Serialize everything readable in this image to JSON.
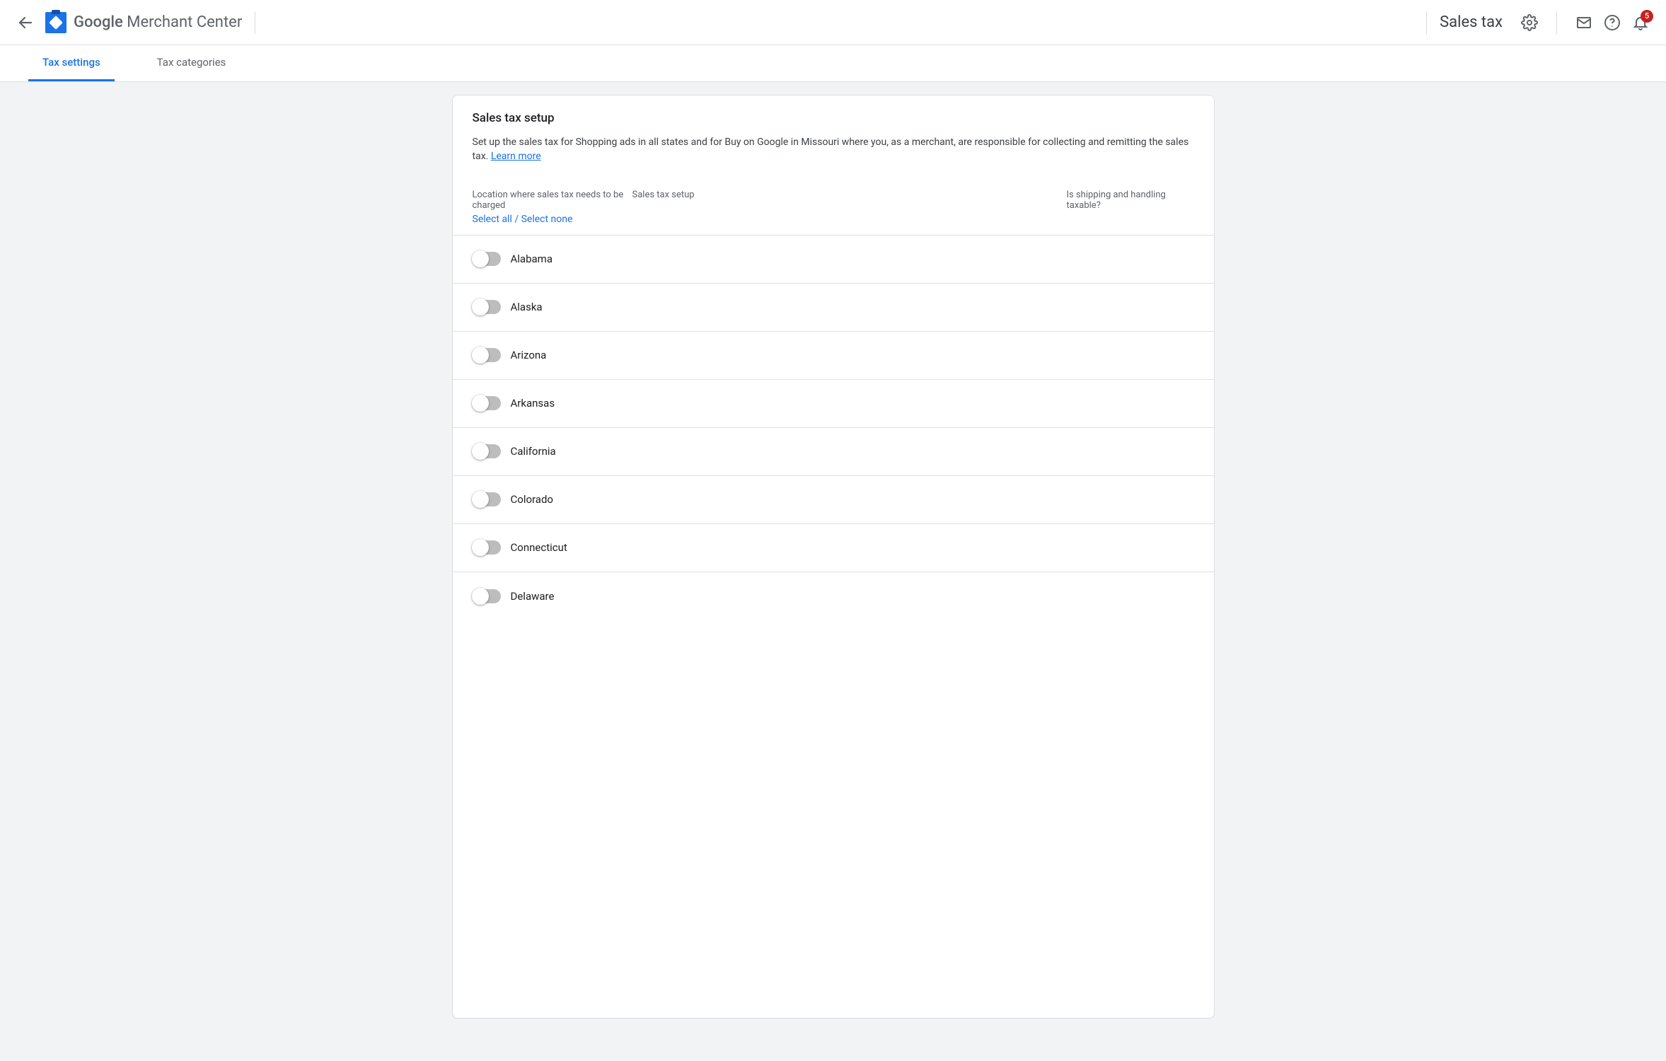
{
  "header": {
    "brand_google": "Google",
    "brand_product": "Merchant Center",
    "page_title": "Sales tax",
    "notification_count": "5"
  },
  "tabs": [
    {
      "label": "Tax settings",
      "active": true
    },
    {
      "label": "Tax categories",
      "active": false
    }
  ],
  "card": {
    "title": "Sales tax setup",
    "description": "Set up the sales tax for Shopping ads in all states and for Buy on Google in Missouri where you, as a merchant, are responsible for collecting and remitting the sales tax. ",
    "learn_more": "Learn more",
    "columns": {
      "location": "Location where sales tax needs to be charged",
      "setup": "Sales tax setup",
      "shipping": "Is shipping and handling taxable?"
    },
    "select_all": "Select all",
    "select_none": "Select none",
    "select_sep": " / "
  },
  "states": [
    {
      "name": "Alabama",
      "enabled": false
    },
    {
      "name": "Alaska",
      "enabled": false
    },
    {
      "name": "Arizona",
      "enabled": false
    },
    {
      "name": "Arkansas",
      "enabled": false
    },
    {
      "name": "California",
      "enabled": false
    },
    {
      "name": "Colorado",
      "enabled": false
    },
    {
      "name": "Connecticut",
      "enabled": false
    },
    {
      "name": "Delaware",
      "enabled": false
    }
  ]
}
